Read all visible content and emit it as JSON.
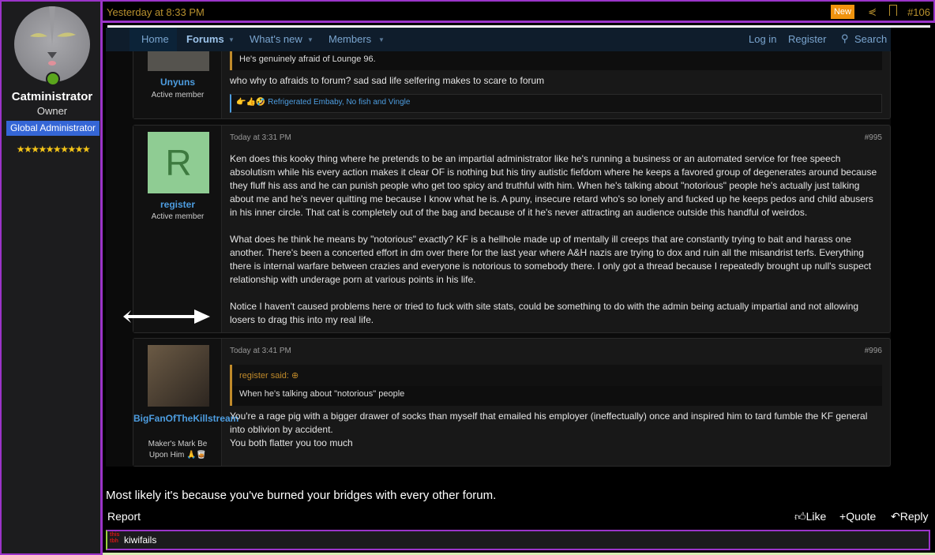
{
  "author": {
    "name": "Catministrator",
    "title": "Owner",
    "banner": "Global Administrator",
    "stars": "★★★★★★★★★★",
    "avatar_icon": "cat-avatar",
    "online_icon": "user-online-icon"
  },
  "post_header": {
    "date": "Yesterday at 8:33 PM",
    "new_badge": "New",
    "post_number": "#106"
  },
  "embedded": {
    "nav": {
      "items": [
        "Home",
        "Forums",
        "What's new",
        "Members"
      ],
      "login": "Log in",
      "register": "Register",
      "search": "Search"
    },
    "posts": [
      {
        "name": "Unyuns",
        "role": "Active member",
        "quote": "He's genuinely afraid of Lounge 96.",
        "body": "who why to afraids to forum? sad sad life selfering makes to scare to forum",
        "reactions": "Refrigerated Embaby, No fish and Vingle",
        "reaction_emojis": "👉👍🤣"
      },
      {
        "name": "register",
        "avatar_letter": "R",
        "role": "Active member",
        "date": "Today at 3:31 PM",
        "number": "#995",
        "paragraphs": [
          "Ken does this kooky thing where he pretends to be an impartial administrator like he's running a business or an automated service for free speech absolutism while his every action makes it clear OF is nothing but his tiny autistic fiefdom where he keeps a favored group of degenerates around because they fluff his ass and he can punish people who get too spicy and truthful with him. When he's talking about \"notorious\" people he's actually just talking about me and he's never quitting me because I know what he is. A puny, insecure retard who's so lonely and fucked up he keeps pedos and child abusers in his inner circle. That cat is completely out of the bag and because of it he's never attracting an audience outside this handful of weirdos.",
          "What does he think he means by \"notorious\" exactly? KF is a hellhole made up of mentally ill creeps that are constantly trying to bait and harass one another. There's been a concerted effort in dm over there for the last year where A&H nazis are trying to dox and ruin all the misandrist terfs. Everything there is internal warfare between crazies and everyone is notorious to somebody there. I only got a thread because I repeatedly brought up null's suspect relationship with underage porn at various points in his life.",
          "Notice I haven't caused problems here or tried to fuck with site stats, could be something to do with the admin being actually impartial and not allowing losers to drag this into my real life."
        ]
      },
      {
        "name": "BigFanOfTheKillstream",
        "role": "Maker's Mark Be Upon Him 🙏🥃",
        "date": "Today at 3:41 PM",
        "number": "#996",
        "quote_author": "register said:",
        "quote": "When he's talking about \"notorious\" people",
        "lines": [
          "You're a rage pig with a bigger drawer of socks than myself that emailed his employer (ineffectually) once and inspired him to tard fumble the KF general into oblivion by accident.",
          "You both flatter you too much"
        ]
      }
    ]
  },
  "body": "Most likely it's because you've burned your bridges with every other forum.",
  "actions": {
    "report": "Report",
    "like": "Like",
    "quote": "Quote",
    "reply": "Reply"
  },
  "signature": {
    "logo_text": "this tbh",
    "text": "kiwifails"
  },
  "colors": {
    "accent": "#9b34c9",
    "gold": "#b8912e",
    "link": "#4d9de0",
    "new_badge": "#f0930e"
  }
}
